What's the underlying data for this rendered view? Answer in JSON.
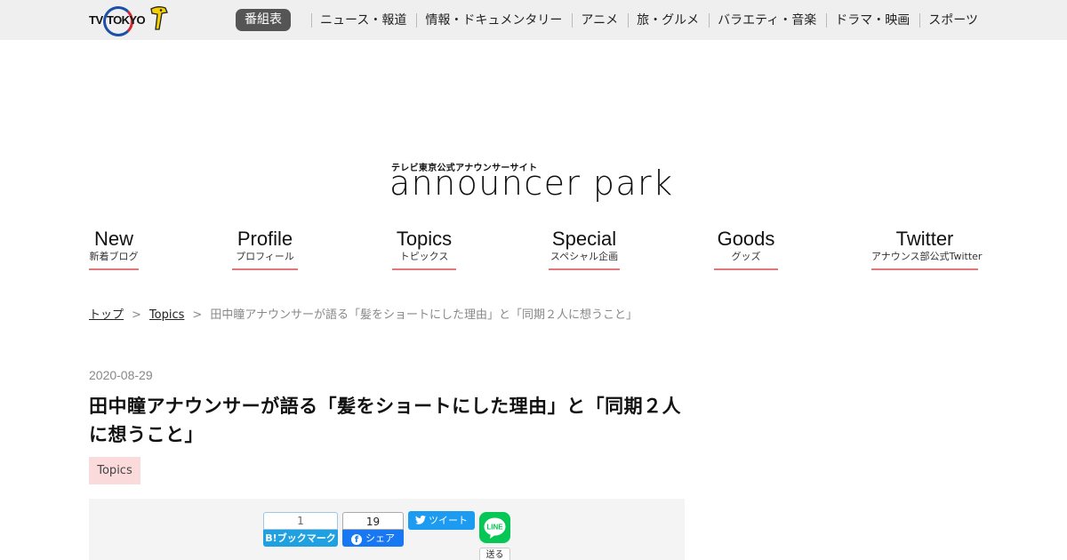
{
  "header": {
    "logo_left": "TV",
    "logo_right": "TOKYO",
    "schedule_label": "番組表",
    "nav": [
      "ニュース・報道",
      "情報・ドキュメンタリー",
      "アニメ",
      "旅・グルメ",
      "バラエティ・音楽",
      "ドラマ・映画",
      "スポーツ"
    ]
  },
  "site_logo": {
    "subtitle": "テレビ東京公式アナウンサーサイト",
    "title": "announcer park"
  },
  "categories": [
    {
      "en": "New",
      "ja": "新着ブログ"
    },
    {
      "en": "Profile",
      "ja": "プロフィール"
    },
    {
      "en": "Topics",
      "ja": "トピックス"
    },
    {
      "en": "Special",
      "ja": "スペシャル企画"
    },
    {
      "en": "Goods",
      "ja": "グッズ"
    },
    {
      "en": "Twitter",
      "ja": "アナウンス部公式Twitter"
    }
  ],
  "breadcrumb": {
    "home": "トップ",
    "section": "Topics",
    "separator": ">",
    "current": "田中瞳アナウンサーが語る「髪をショートにした理由」と「同期２人に想うこと」"
  },
  "article": {
    "date": "2020-08-29",
    "title": "田中瞳アナウンサーが語る「髪をショートにした理由」と「同期２人に想うこと」",
    "tag": "Topics"
  },
  "share": {
    "hatena_count": "1",
    "hatena_label": "B!ブックマーク",
    "facebook_count": "19",
    "facebook_label": "シェア",
    "twitter_label": "ツイート",
    "line_label": "LINE",
    "line_send_label": "送る"
  },
  "colors": {
    "topbar_bg": "#efefef",
    "accent_underline": "#e1787a",
    "tag_bg": "#fadadb",
    "hatena_blue": "#1fa0e0",
    "facebook_blue": "#1877f2",
    "twitter_blue": "#1d9bf0",
    "line_green": "#06c755"
  }
}
